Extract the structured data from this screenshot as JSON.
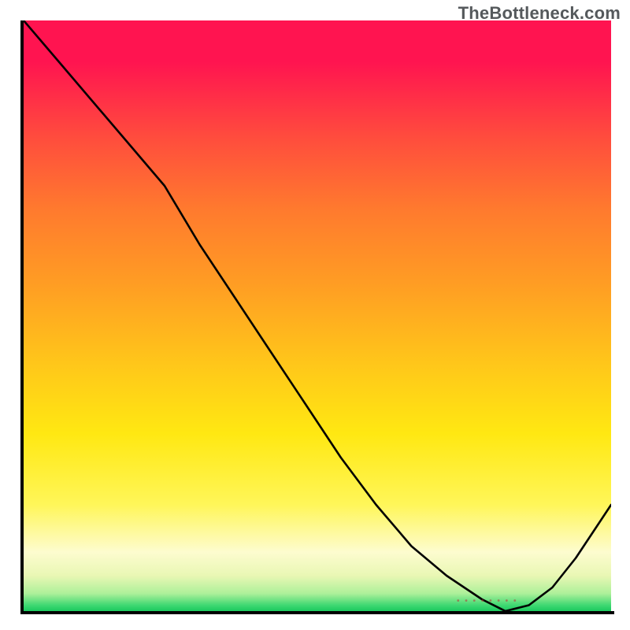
{
  "watermark": "TheBottleneck.com",
  "chart_data": {
    "type": "line",
    "title": "",
    "xlabel": "",
    "ylabel": "",
    "xlim": [
      0,
      100
    ],
    "ylim": [
      0,
      100
    ],
    "grid": false,
    "legend": false,
    "background": {
      "type": "vertical-gradient",
      "stops": [
        {
          "pos": 0.0,
          "color": "#ff1450",
          "meaning": "severe bottleneck"
        },
        {
          "pos": 0.45,
          "color": "#ff9e23",
          "meaning": "high"
        },
        {
          "pos": 0.7,
          "color": "#ffe812",
          "meaning": "moderate"
        },
        {
          "pos": 0.9,
          "color": "#fdfccf",
          "meaning": "low"
        },
        {
          "pos": 1.0,
          "color": "#1bc95e",
          "meaning": "no bottleneck"
        }
      ]
    },
    "series": [
      {
        "name": "bottleneck-curve",
        "color": "#000000",
        "x": [
          0,
          6,
          12,
          18,
          24,
          30,
          36,
          42,
          48,
          54,
          60,
          66,
          72,
          78,
          82,
          86,
          90,
          94,
          100
        ],
        "y": [
          100,
          93,
          86,
          79,
          72,
          62,
          53,
          44,
          35,
          26,
          18,
          11,
          6,
          2,
          0,
          1,
          4,
          9,
          18
        ]
      }
    ],
    "annotations": [
      {
        "text": "• • • • • • • •",
        "x": 80,
        "y": 0,
        "meaning": "optimal-range-marker"
      }
    ]
  }
}
